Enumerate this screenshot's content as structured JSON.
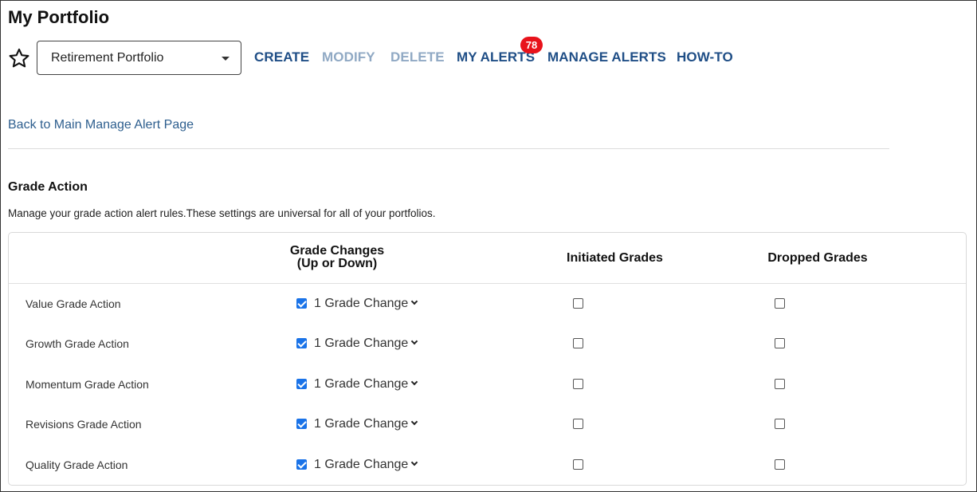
{
  "header": {
    "title": "My Portfolio"
  },
  "toolbar": {
    "portfolio_select": {
      "value": "Retirement Portfolio"
    },
    "nav": [
      {
        "label": "CREATE",
        "enabled": true
      },
      {
        "label": "MODIFY",
        "enabled": false
      },
      {
        "label": "DELETE",
        "enabled": false
      },
      {
        "label": "MY ALERTS",
        "enabled": true
      },
      {
        "label": "MANAGE ALERTS",
        "enabled": true
      },
      {
        "label": "HOW-TO",
        "enabled": true
      }
    ],
    "alerts_badge": "78"
  },
  "back_link": "Back to Main Manage Alert Page",
  "section": {
    "title": "Grade Action",
    "description": "Manage your grade action alert rules.These settings are universal for all of your portfolios."
  },
  "table": {
    "headers": {
      "grade_changes_1": "Grade Changes",
      "grade_changes_2": "(Up or Down)",
      "initiated": "Initiated Grades",
      "dropped": "Dropped Grades"
    },
    "rows": [
      {
        "label": "Value Grade Action",
        "grade_change_checked": true,
        "grade_change_value": "1 Grade Change",
        "initiated_checked": false,
        "dropped_checked": false
      },
      {
        "label": "Growth Grade Action",
        "grade_change_checked": true,
        "grade_change_value": "1 Grade Change",
        "initiated_checked": false,
        "dropped_checked": false
      },
      {
        "label": "Momentum Grade Action",
        "grade_change_checked": true,
        "grade_change_value": "1 Grade Change",
        "initiated_checked": false,
        "dropped_checked": false
      },
      {
        "label": "Revisions Grade Action",
        "grade_change_checked": true,
        "grade_change_value": "1 Grade Change",
        "initiated_checked": false,
        "dropped_checked": false
      },
      {
        "label": "Quality Grade Action",
        "grade_change_checked": true,
        "grade_change_value": "1 Grade Change",
        "initiated_checked": false,
        "dropped_checked": false
      }
    ]
  },
  "colors": {
    "nav_active": "#1f4e86",
    "nav_disabled": "#90a9c4",
    "badge": "#e8131b",
    "link": "#2d5e8e",
    "checkbox": "#1a73e8"
  },
  "icons": {
    "favorite": "star-outline-icon",
    "select_caret": "caret-down-icon",
    "dropdown": "chevron-down-icon"
  }
}
